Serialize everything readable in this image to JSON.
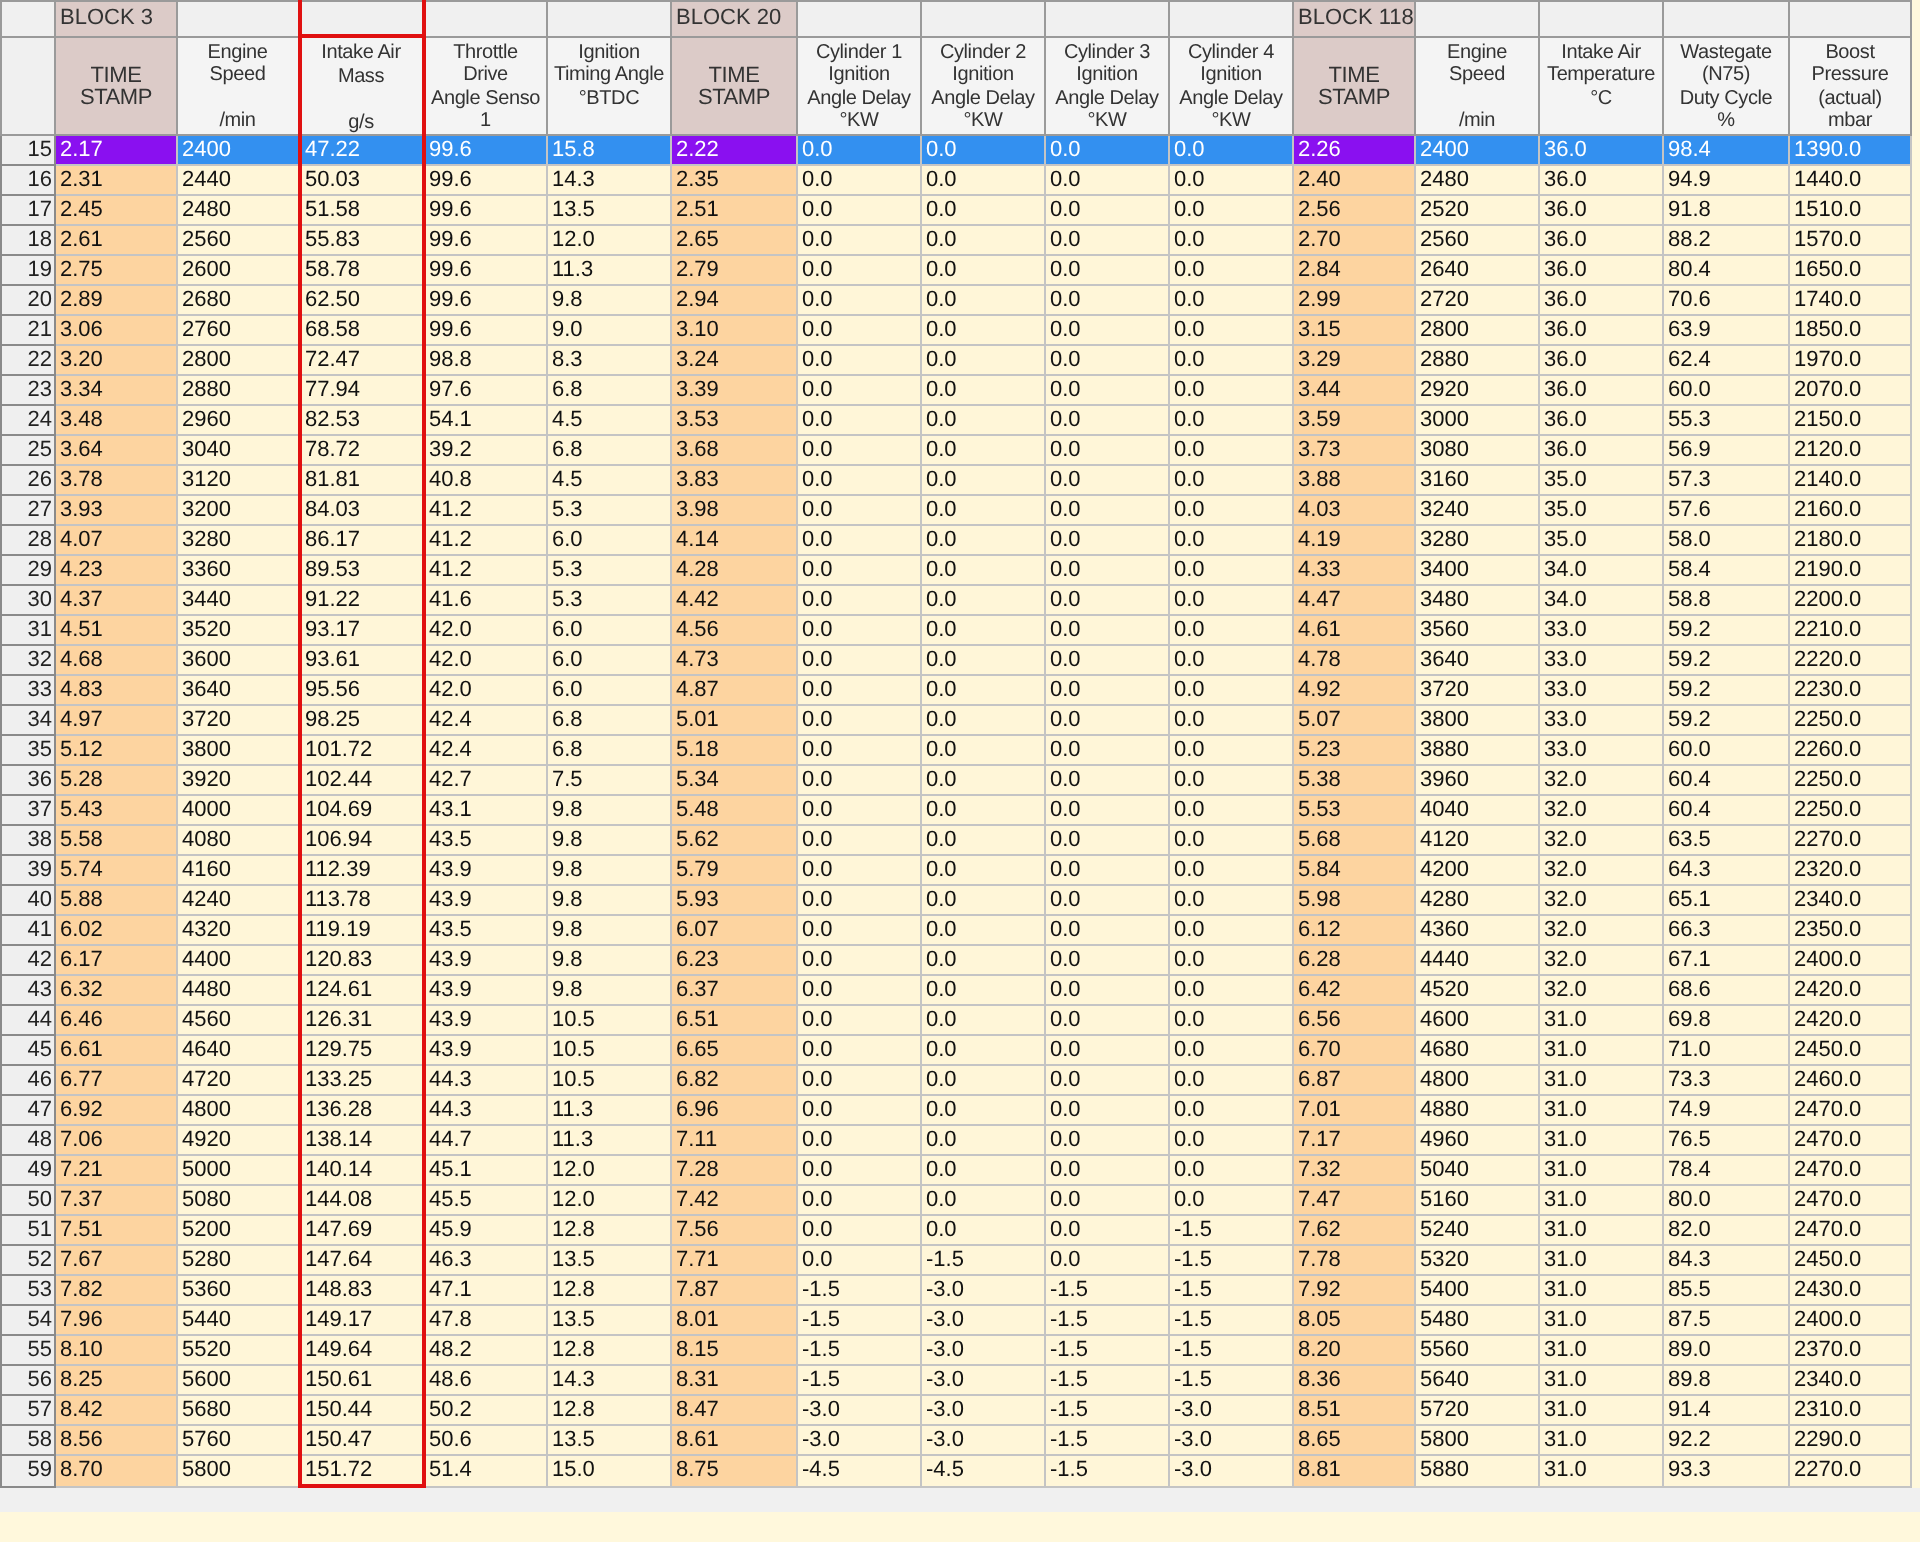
{
  "columns": [
    {
      "kind": "timestamp",
      "block": "BLOCK 3",
      "lines": [
        "TIME",
        "STAMP"
      ],
      "highlighted": false
    },
    {
      "kind": "value",
      "lines": [
        "Engine",
        "Speed"
      ],
      "unit": "/min",
      "highlighted": false
    },
    {
      "kind": "value",
      "lines": [
        "Intake Air",
        "Mass"
      ],
      "unit": "g/s",
      "highlighted": true
    },
    {
      "kind": "value",
      "lines": [
        "Throttle",
        "Drive",
        "Angle Senso",
        "1"
      ],
      "highlighted": false
    },
    {
      "kind": "value",
      "lines": [
        "Ignition",
        "Timing Angle",
        "°BTDC"
      ],
      "highlighted": false
    },
    {
      "kind": "timestamp",
      "block": "BLOCK 20",
      "lines": [
        "TIME",
        "STAMP"
      ],
      "highlighted": false
    },
    {
      "kind": "value",
      "lines": [
        "Cylinder 1",
        "Ignition",
        "Angle Delay",
        "°KW"
      ],
      "highlighted": false
    },
    {
      "kind": "value",
      "lines": [
        "Cylinder 2",
        "Ignition",
        "Angle Delay",
        "°KW"
      ],
      "highlighted": false
    },
    {
      "kind": "value",
      "lines": [
        "Cylinder 3",
        "Ignition",
        "Angle Delay",
        "°KW"
      ],
      "highlighted": false
    },
    {
      "kind": "value",
      "lines": [
        "Cylinder 4",
        "Ignition",
        "Angle Delay",
        "°KW"
      ],
      "highlighted": false
    },
    {
      "kind": "timestamp",
      "block": "BLOCK 118",
      "lines": [
        "TIME",
        "STAMP"
      ],
      "highlighted": false
    },
    {
      "kind": "value",
      "lines": [
        "Engine",
        "Speed"
      ],
      "unit": "/min",
      "highlighted": false
    },
    {
      "kind": "value",
      "lines": [
        "Intake Air",
        "Temperature",
        "°C"
      ],
      "highlighted": false
    },
    {
      "kind": "value",
      "lines": [
        "Wastegate",
        "(N75)",
        "Duty Cycle",
        "%"
      ],
      "highlighted": false
    },
    {
      "kind": "value",
      "lines": [
        "Boost",
        "Pressure",
        "(actual)",
        "mbar"
      ],
      "highlighted": false
    }
  ],
  "rows": [
    {
      "number": "15",
      "selected": true,
      "cells": [
        "2.17",
        "2400",
        "47.22",
        "99.6",
        "15.8",
        "2.22",
        "0.0",
        "0.0",
        "0.0",
        "0.0",
        "2.26",
        "2400",
        "36.0",
        "98.4",
        "1390.0"
      ]
    },
    {
      "number": "16",
      "selected": false,
      "cells": [
        "2.31",
        "2440",
        "50.03",
        "99.6",
        "14.3",
        "2.35",
        "0.0",
        "0.0",
        "0.0",
        "0.0",
        "2.40",
        "2480",
        "36.0",
        "94.9",
        "1440.0"
      ]
    },
    {
      "number": "17",
      "selected": false,
      "cells": [
        "2.45",
        "2480",
        "51.58",
        "99.6",
        "13.5",
        "2.51",
        "0.0",
        "0.0",
        "0.0",
        "0.0",
        "2.56",
        "2520",
        "36.0",
        "91.8",
        "1510.0"
      ]
    },
    {
      "number": "18",
      "selected": false,
      "cells": [
        "2.61",
        "2560",
        "55.83",
        "99.6",
        "12.0",
        "2.65",
        "0.0",
        "0.0",
        "0.0",
        "0.0",
        "2.70",
        "2560",
        "36.0",
        "88.2",
        "1570.0"
      ]
    },
    {
      "number": "19",
      "selected": false,
      "cells": [
        "2.75",
        "2600",
        "58.78",
        "99.6",
        "11.3",
        "2.79",
        "0.0",
        "0.0",
        "0.0",
        "0.0",
        "2.84",
        "2640",
        "36.0",
        "80.4",
        "1650.0"
      ]
    },
    {
      "number": "20",
      "selected": false,
      "cells": [
        "2.89",
        "2680",
        "62.50",
        "99.6",
        "9.8",
        "2.94",
        "0.0",
        "0.0",
        "0.0",
        "0.0",
        "2.99",
        "2720",
        "36.0",
        "70.6",
        "1740.0"
      ]
    },
    {
      "number": "21",
      "selected": false,
      "cells": [
        "3.06",
        "2760",
        "68.58",
        "99.6",
        "9.0",
        "3.10",
        "0.0",
        "0.0",
        "0.0",
        "0.0",
        "3.15",
        "2800",
        "36.0",
        "63.9",
        "1850.0"
      ]
    },
    {
      "number": "22",
      "selected": false,
      "cells": [
        "3.20",
        "2800",
        "72.47",
        "98.8",
        "8.3",
        "3.24",
        "0.0",
        "0.0",
        "0.0",
        "0.0",
        "3.29",
        "2880",
        "36.0",
        "62.4",
        "1970.0"
      ]
    },
    {
      "number": "23",
      "selected": false,
      "cells": [
        "3.34",
        "2880",
        "77.94",
        "97.6",
        "6.8",
        "3.39",
        "0.0",
        "0.0",
        "0.0",
        "0.0",
        "3.44",
        "2920",
        "36.0",
        "60.0",
        "2070.0"
      ]
    },
    {
      "number": "24",
      "selected": false,
      "cells": [
        "3.48",
        "2960",
        "82.53",
        "54.1",
        "4.5",
        "3.53",
        "0.0",
        "0.0",
        "0.0",
        "0.0",
        "3.59",
        "3000",
        "36.0",
        "55.3",
        "2150.0"
      ]
    },
    {
      "number": "25",
      "selected": false,
      "cells": [
        "3.64",
        "3040",
        "78.72",
        "39.2",
        "6.8",
        "3.68",
        "0.0",
        "0.0",
        "0.0",
        "0.0",
        "3.73",
        "3080",
        "36.0",
        "56.9",
        "2120.0"
      ]
    },
    {
      "number": "26",
      "selected": false,
      "cells": [
        "3.78",
        "3120",
        "81.81",
        "40.8",
        "4.5",
        "3.83",
        "0.0",
        "0.0",
        "0.0",
        "0.0",
        "3.88",
        "3160",
        "35.0",
        "57.3",
        "2140.0"
      ]
    },
    {
      "number": "27",
      "selected": false,
      "cells": [
        "3.93",
        "3200",
        "84.03",
        "41.2",
        "5.3",
        "3.98",
        "0.0",
        "0.0",
        "0.0",
        "0.0",
        "4.03",
        "3240",
        "35.0",
        "57.6",
        "2160.0"
      ]
    },
    {
      "number": "28",
      "selected": false,
      "cells": [
        "4.07",
        "3280",
        "86.17",
        "41.2",
        "6.0",
        "4.14",
        "0.0",
        "0.0",
        "0.0",
        "0.0",
        "4.19",
        "3280",
        "35.0",
        "58.0",
        "2180.0"
      ]
    },
    {
      "number": "29",
      "selected": false,
      "cells": [
        "4.23",
        "3360",
        "89.53",
        "41.2",
        "5.3",
        "4.28",
        "0.0",
        "0.0",
        "0.0",
        "0.0",
        "4.33",
        "3400",
        "34.0",
        "58.4",
        "2190.0"
      ]
    },
    {
      "number": "30",
      "selected": false,
      "cells": [
        "4.37",
        "3440",
        "91.22",
        "41.6",
        "5.3",
        "4.42",
        "0.0",
        "0.0",
        "0.0",
        "0.0",
        "4.47",
        "3480",
        "34.0",
        "58.8",
        "2200.0"
      ]
    },
    {
      "number": "31",
      "selected": false,
      "cells": [
        "4.51",
        "3520",
        "93.17",
        "42.0",
        "6.0",
        "4.56",
        "0.0",
        "0.0",
        "0.0",
        "0.0",
        "4.61",
        "3560",
        "33.0",
        "59.2",
        "2210.0"
      ]
    },
    {
      "number": "32",
      "selected": false,
      "cells": [
        "4.68",
        "3600",
        "93.61",
        "42.0",
        "6.0",
        "4.73",
        "0.0",
        "0.0",
        "0.0",
        "0.0",
        "4.78",
        "3640",
        "33.0",
        "59.2",
        "2220.0"
      ]
    },
    {
      "number": "33",
      "selected": false,
      "cells": [
        "4.83",
        "3640",
        "95.56",
        "42.0",
        "6.0",
        "4.87",
        "0.0",
        "0.0",
        "0.0",
        "0.0",
        "4.92",
        "3720",
        "33.0",
        "59.2",
        "2230.0"
      ]
    },
    {
      "number": "34",
      "selected": false,
      "cells": [
        "4.97",
        "3720",
        "98.25",
        "42.4",
        "6.8",
        "5.01",
        "0.0",
        "0.0",
        "0.0",
        "0.0",
        "5.07",
        "3800",
        "33.0",
        "59.2",
        "2250.0"
      ]
    },
    {
      "number": "35",
      "selected": false,
      "cells": [
        "5.12",
        "3800",
        "101.72",
        "42.4",
        "6.8",
        "5.18",
        "0.0",
        "0.0",
        "0.0",
        "0.0",
        "5.23",
        "3880",
        "33.0",
        "60.0",
        "2260.0"
      ]
    },
    {
      "number": "36",
      "selected": false,
      "cells": [
        "5.28",
        "3920",
        "102.44",
        "42.7",
        "7.5",
        "5.34",
        "0.0",
        "0.0",
        "0.0",
        "0.0",
        "5.38",
        "3960",
        "32.0",
        "60.4",
        "2250.0"
      ]
    },
    {
      "number": "37",
      "selected": false,
      "cells": [
        "5.43",
        "4000",
        "104.69",
        "43.1",
        "9.8",
        "5.48",
        "0.0",
        "0.0",
        "0.0",
        "0.0",
        "5.53",
        "4040",
        "32.0",
        "60.4",
        "2250.0"
      ]
    },
    {
      "number": "38",
      "selected": false,
      "cells": [
        "5.58",
        "4080",
        "106.94",
        "43.5",
        "9.8",
        "5.62",
        "0.0",
        "0.0",
        "0.0",
        "0.0",
        "5.68",
        "4120",
        "32.0",
        "63.5",
        "2270.0"
      ]
    },
    {
      "number": "39",
      "selected": false,
      "cells": [
        "5.74",
        "4160",
        "112.39",
        "43.9",
        "9.8",
        "5.79",
        "0.0",
        "0.0",
        "0.0",
        "0.0",
        "5.84",
        "4200",
        "32.0",
        "64.3",
        "2320.0"
      ]
    },
    {
      "number": "40",
      "selected": false,
      "cells": [
        "5.88",
        "4240",
        "113.78",
        "43.9",
        "9.8",
        "5.93",
        "0.0",
        "0.0",
        "0.0",
        "0.0",
        "5.98",
        "4280",
        "32.0",
        "65.1",
        "2340.0"
      ]
    },
    {
      "number": "41",
      "selected": false,
      "cells": [
        "6.02",
        "4320",
        "119.19",
        "43.5",
        "9.8",
        "6.07",
        "0.0",
        "0.0",
        "0.0",
        "0.0",
        "6.12",
        "4360",
        "32.0",
        "66.3",
        "2350.0"
      ]
    },
    {
      "number": "42",
      "selected": false,
      "cells": [
        "6.17",
        "4400",
        "120.83",
        "43.9",
        "9.8",
        "6.23",
        "0.0",
        "0.0",
        "0.0",
        "0.0",
        "6.28",
        "4440",
        "32.0",
        "67.1",
        "2400.0"
      ]
    },
    {
      "number": "43",
      "selected": false,
      "cells": [
        "6.32",
        "4480",
        "124.61",
        "43.9",
        "9.8",
        "6.37",
        "0.0",
        "0.0",
        "0.0",
        "0.0",
        "6.42",
        "4520",
        "32.0",
        "68.6",
        "2420.0"
      ]
    },
    {
      "number": "44",
      "selected": false,
      "cells": [
        "6.46",
        "4560",
        "126.31",
        "43.9",
        "10.5",
        "6.51",
        "0.0",
        "0.0",
        "0.0",
        "0.0",
        "6.56",
        "4600",
        "31.0",
        "69.8",
        "2420.0"
      ]
    },
    {
      "number": "45",
      "selected": false,
      "cells": [
        "6.61",
        "4640",
        "129.75",
        "43.9",
        "10.5",
        "6.65",
        "0.0",
        "0.0",
        "0.0",
        "0.0",
        "6.70",
        "4680",
        "31.0",
        "71.0",
        "2450.0"
      ]
    },
    {
      "number": "46",
      "selected": false,
      "cells": [
        "6.77",
        "4720",
        "133.25",
        "44.3",
        "10.5",
        "6.82",
        "0.0",
        "0.0",
        "0.0",
        "0.0",
        "6.87",
        "4800",
        "31.0",
        "73.3",
        "2460.0"
      ]
    },
    {
      "number": "47",
      "selected": false,
      "cells": [
        "6.92",
        "4800",
        "136.28",
        "44.3",
        "11.3",
        "6.96",
        "0.0",
        "0.0",
        "0.0",
        "0.0",
        "7.01",
        "4880",
        "31.0",
        "74.9",
        "2470.0"
      ]
    },
    {
      "number": "48",
      "selected": false,
      "cells": [
        "7.06",
        "4920",
        "138.14",
        "44.7",
        "11.3",
        "7.11",
        "0.0",
        "0.0",
        "0.0",
        "0.0",
        "7.17",
        "4960",
        "31.0",
        "76.5",
        "2470.0"
      ]
    },
    {
      "number": "49",
      "selected": false,
      "cells": [
        "7.21",
        "5000",
        "140.14",
        "45.1",
        "12.0",
        "7.28",
        "0.0",
        "0.0",
        "0.0",
        "0.0",
        "7.32",
        "5040",
        "31.0",
        "78.4",
        "2470.0"
      ]
    },
    {
      "number": "50",
      "selected": false,
      "cells": [
        "7.37",
        "5080",
        "144.08",
        "45.5",
        "12.0",
        "7.42",
        "0.0",
        "0.0",
        "0.0",
        "0.0",
        "7.47",
        "5160",
        "31.0",
        "80.0",
        "2470.0"
      ]
    },
    {
      "number": "51",
      "selected": false,
      "cells": [
        "7.51",
        "5200",
        "147.69",
        "45.9",
        "12.8",
        "7.56",
        "0.0",
        "0.0",
        "0.0",
        "-1.5",
        "7.62",
        "5240",
        "31.0",
        "82.0",
        "2470.0"
      ]
    },
    {
      "number": "52",
      "selected": false,
      "cells": [
        "7.67",
        "5280",
        "147.64",
        "46.3",
        "13.5",
        "7.71",
        "0.0",
        "-1.5",
        "0.0",
        "-1.5",
        "7.78",
        "5320",
        "31.0",
        "84.3",
        "2450.0"
      ]
    },
    {
      "number": "53",
      "selected": false,
      "cells": [
        "7.82",
        "5360",
        "148.83",
        "47.1",
        "12.8",
        "7.87",
        "-1.5",
        "-3.0",
        "-1.5",
        "-1.5",
        "7.92",
        "5400",
        "31.0",
        "85.5",
        "2430.0"
      ]
    },
    {
      "number": "54",
      "selected": false,
      "cells": [
        "7.96",
        "5440",
        "149.17",
        "47.8",
        "13.5",
        "8.01",
        "-1.5",
        "-3.0",
        "-1.5",
        "-1.5",
        "8.05",
        "5480",
        "31.0",
        "87.5",
        "2400.0"
      ]
    },
    {
      "number": "55",
      "selected": false,
      "cells": [
        "8.10",
        "5520",
        "149.64",
        "48.2",
        "12.8",
        "8.15",
        "-1.5",
        "-3.0",
        "-1.5",
        "-1.5",
        "8.20",
        "5560",
        "31.0",
        "89.0",
        "2370.0"
      ]
    },
    {
      "number": "56",
      "selected": false,
      "cells": [
        "8.25",
        "5600",
        "150.61",
        "48.6",
        "14.3",
        "8.31",
        "-1.5",
        "-3.0",
        "-1.5",
        "-1.5",
        "8.36",
        "5640",
        "31.0",
        "89.8",
        "2340.0"
      ]
    },
    {
      "number": "57",
      "selected": false,
      "cells": [
        "8.42",
        "5680",
        "150.44",
        "50.2",
        "12.8",
        "8.47",
        "-3.0",
        "-3.0",
        "-1.5",
        "-3.0",
        "8.51",
        "5720",
        "31.0",
        "91.4",
        "2310.0"
      ]
    },
    {
      "number": "58",
      "selected": false,
      "cells": [
        "8.56",
        "5760",
        "150.47",
        "50.6",
        "13.5",
        "8.61",
        "-3.0",
        "-3.0",
        "-1.5",
        "-3.0",
        "8.65",
        "5800",
        "31.0",
        "92.2",
        "2290.0"
      ]
    },
    {
      "number": "59",
      "selected": false,
      "cells": [
        "8.70",
        "5800",
        "151.72",
        "51.4",
        "15.0",
        "8.75",
        "-4.5",
        "-4.5",
        "-1.5",
        "-3.0",
        "8.81",
        "5880",
        "31.0",
        "93.3",
        "2270.0"
      ]
    }
  ]
}
